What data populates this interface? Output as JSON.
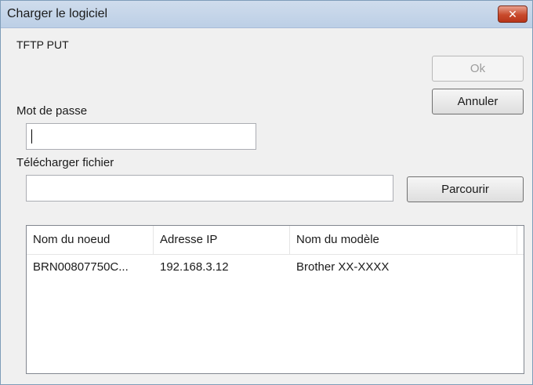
{
  "window": {
    "title": "Charger le logiciel",
    "close_glyph": "✕"
  },
  "protocol_label": "TFTP PUT",
  "password": {
    "label": "Mot de passe",
    "value": ""
  },
  "upload": {
    "label": "Télécharger fichier",
    "value": "",
    "browse_label": "Parcourir"
  },
  "buttons": {
    "ok_label": "Ok",
    "cancel_label": "Annuler"
  },
  "list": {
    "columns": [
      "Nom du noeud",
      "Adresse IP",
      "Nom du modèle"
    ],
    "rows": [
      [
        "BRN00807750C...",
        "192.168.3.12",
        "Brother XX-XXXX"
      ]
    ]
  }
}
